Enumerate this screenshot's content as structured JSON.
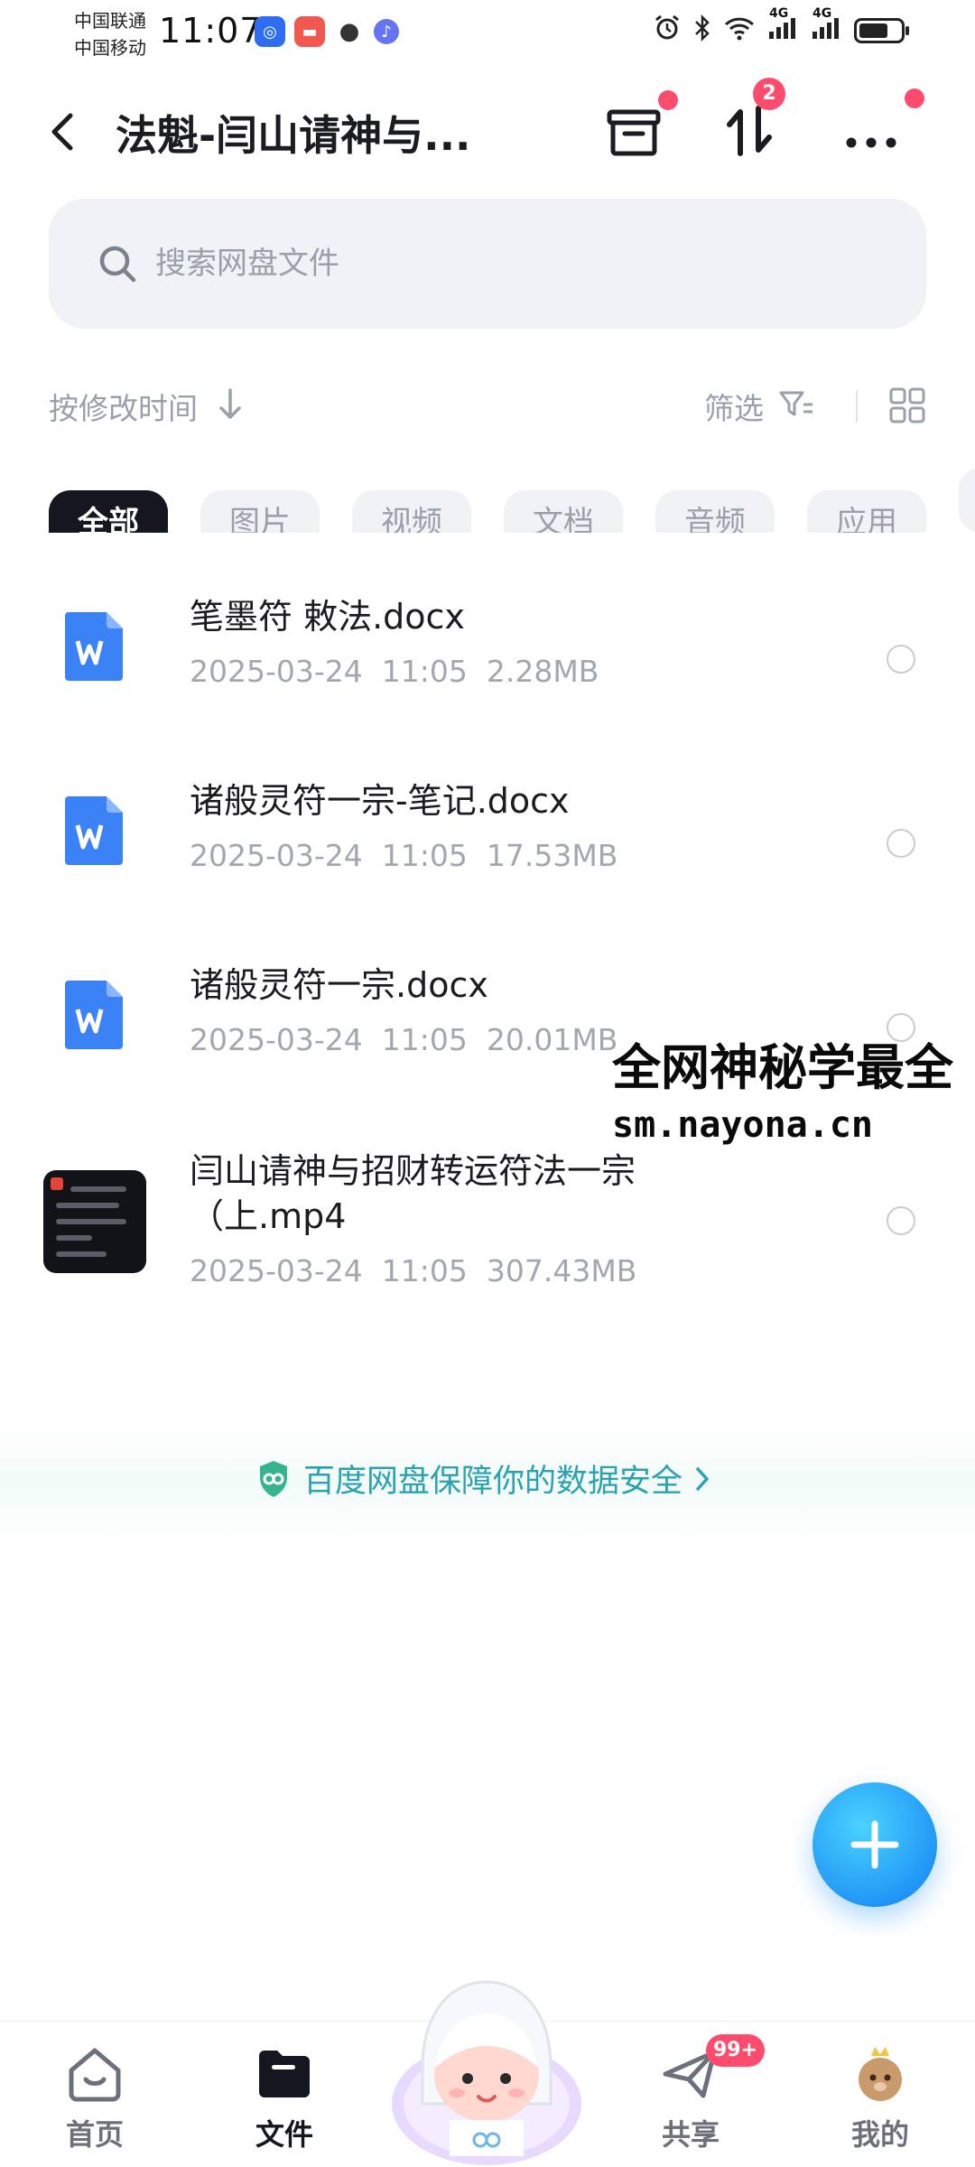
{
  "status_bar": {
    "carrier_1": "中国联通",
    "carrier_2": "中国移动",
    "time": "11:07",
    "network_1": "4G",
    "network_2": "4G",
    "battery_level": 0.7
  },
  "header": {
    "title": "法魁-闫山请神与...",
    "transfer_badge": "2"
  },
  "search": {
    "placeholder": "搜索网盘文件"
  },
  "sort_bar": {
    "sort_label": "按修改时间",
    "filter_label": "筛选"
  },
  "tabs": [
    "全部",
    "图片",
    "视频",
    "文档",
    "音频",
    "应用"
  ],
  "files": [
    {
      "name": "笔墨符 敕法.docx",
      "date": "2025-03-24",
      "time": "11:05",
      "size": "2.28MB",
      "type": "word-icon"
    },
    {
      "name": "诸般灵符一宗-笔记.docx",
      "date": "2025-03-24",
      "time": "11:05",
      "size": "17.53MB",
      "type": "word-icon"
    },
    {
      "name": "诸般灵符一宗.docx",
      "date": "2025-03-24",
      "time": "11:05",
      "size": "20.01MB",
      "type": "word-icon"
    },
    {
      "name_line1": "闫山请神与招财转运符法一宗",
      "name_line2": "（上.mp4",
      "date": "2025-03-24",
      "time": "11:05",
      "size": "307.43MB",
      "type": "video-thumbnail"
    }
  ],
  "watermark": {
    "line1": "全网神秘学最全",
    "line2": "sm.nayona.cn"
  },
  "security_banner": {
    "text": "百度网盘保障你的数据安全"
  },
  "bottom_nav": {
    "items": [
      {
        "label": "首页",
        "icon": "home-icon"
      },
      {
        "label": "文件",
        "icon": "folder-icon",
        "active": true
      },
      {
        "label": "",
        "icon": "mascot-icon"
      },
      {
        "label": "共享",
        "icon": "paper-plane-icon",
        "badge": "99+"
      },
      {
        "label": "我的",
        "icon": "avatar-icon"
      }
    ]
  },
  "colors": {
    "accent": "#1c8ff5",
    "badge": "#ff4b6e",
    "word_icon": "#3b82f6",
    "banner_text": "#2aa2b0"
  }
}
